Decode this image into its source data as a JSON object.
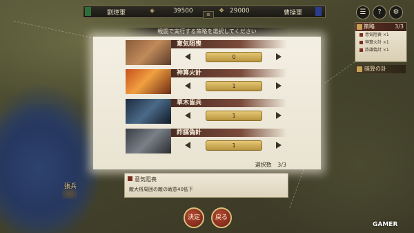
{
  "topbar": {
    "force_name": "劉璋軍",
    "gold": "39500",
    "food": "29000",
    "opponent_name": "曹操軍",
    "tab": "≡",
    "colors": {
      "ally_flag": "#2f6e3a",
      "enemy_flag": "#2b3d8e"
    }
  },
  "system_icons": [
    {
      "name": "menu-icon",
      "glyph": "☰"
    },
    {
      "name": "help-icon",
      "glyph": "?"
    },
    {
      "name": "settings-gear-icon",
      "glyph": "⚙"
    }
  ],
  "strategy_panel": {
    "title": "策略",
    "count": "3/3",
    "rows": [
      "意気阻喪 ×1",
      "神算火計 ×1",
      "詐謀偽計 ×1"
    ],
    "footer": "暗算の計"
  },
  "dialog": {
    "header": "戦闘で実行する策略を選択してください",
    "items": [
      {
        "name": "意気阻喪",
        "value": "0"
      },
      {
        "name": "神算火計",
        "value": "1"
      },
      {
        "name": "草木皆兵",
        "value": "1"
      },
      {
        "name": "詐謀偽計",
        "value": "1"
      }
    ],
    "selection_label": "選択数",
    "selection_count": "3/3"
  },
  "description": {
    "title": "意気阻喪",
    "body": "敵大将周囲の敵の戦意40低下"
  },
  "buttons": {
    "confirm": "決定",
    "back": "戻る"
  },
  "map": {
    "unit_label": "張兵"
  },
  "watermark": "GAMER"
}
